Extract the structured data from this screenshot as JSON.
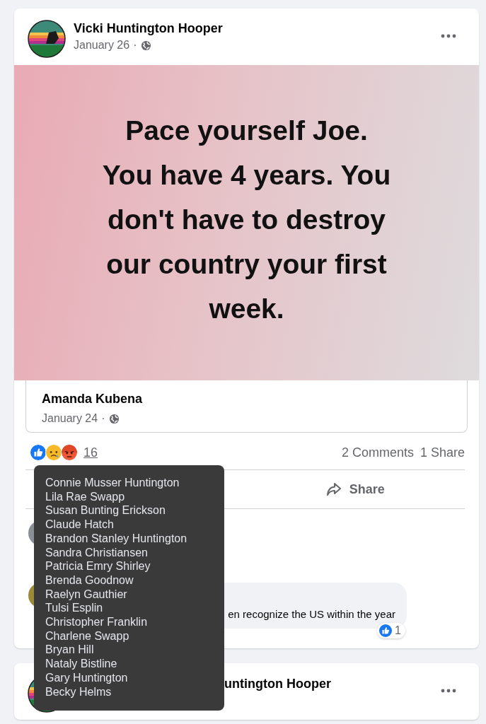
{
  "posts": [
    {
      "author": "Vicki Huntington Hooper",
      "covered": false,
      "date": "January 26",
      "separator": "·",
      "shared": {
        "image_lines": [
          "Pace yourself Joe.",
          "You have 4 years. You",
          "don't have to destroy",
          "our country your first",
          "week."
        ],
        "author": "Amanda Kubena",
        "date": "January 24",
        "separator": "·"
      },
      "reactions": [
        {
          "kind": "like"
        },
        {
          "kind": "sad"
        },
        {
          "kind": "angry"
        }
      ],
      "reaction_count": "16",
      "comments_count": "2 Comments",
      "shares_count": "1 Share",
      "actions": [
        {
          "kind": "share",
          "label": "Share"
        }
      ],
      "comments": [
        {
          "kind": "covered"
        },
        {
          "kind": "text",
          "text": "en recognize the US within the year",
          "reaction": {
            "kind": "like",
            "count": "1"
          }
        }
      ]
    },
    {
      "author": "untington Hooper",
      "covered": true
    }
  ],
  "tooltip": {
    "names": [
      "Connie Musser Huntington",
      "Lila Rae Swapp",
      "Susan Bunting Erickson",
      "Claude Hatch",
      "Brandon Stanley Huntington",
      "Sandra Christiansen",
      "Patricia Emry Shirley",
      "Brenda Goodnow",
      "Raelyn Gauthier",
      "Tulsi Esplin",
      "Christopher Franklin",
      "Charlene Swapp",
      "Bryan Hill",
      "Nataly Bistline",
      "Gary Huntington",
      "Becky Helms"
    ]
  }
}
